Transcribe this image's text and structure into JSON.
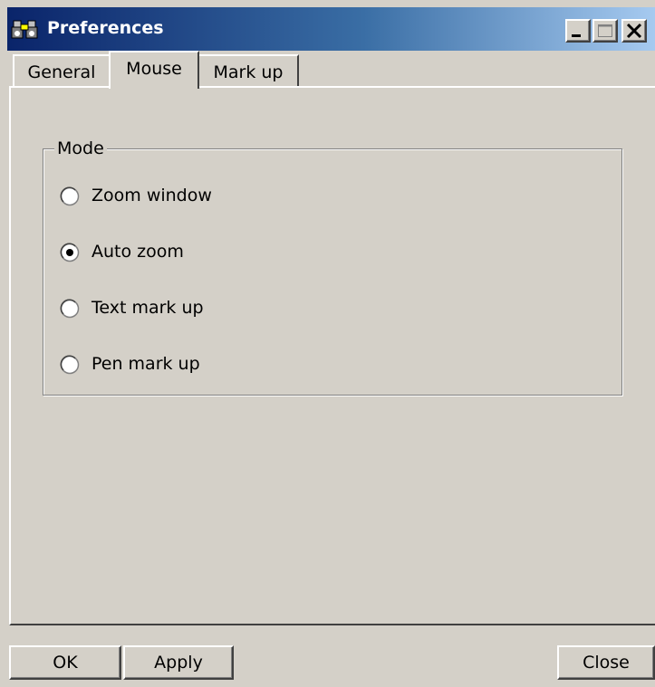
{
  "window": {
    "title": "Preferences",
    "title_icon": "binoculars-icon",
    "titlebar_color_left": "#0a246a",
    "titlebar_color_right": "#a6caf0",
    "controls": {
      "minimize_icon": "minimize-icon",
      "maximize_icon": "maximize-icon",
      "close_icon": "close-icon"
    }
  },
  "tabs": [
    {
      "label": "General",
      "selected": false
    },
    {
      "label": "Mouse",
      "selected": true
    },
    {
      "label": "Mark up",
      "selected": false
    }
  ],
  "mode_group": {
    "legend": "Mode",
    "options": [
      {
        "label": "Zoom window",
        "checked": false
      },
      {
        "label": "Auto zoom",
        "checked": true
      },
      {
        "label": "Text mark up",
        "checked": false
      },
      {
        "label": "Pen mark up",
        "checked": false
      }
    ]
  },
  "buttons": {
    "ok": "OK",
    "apply": "Apply",
    "close": "Close"
  }
}
